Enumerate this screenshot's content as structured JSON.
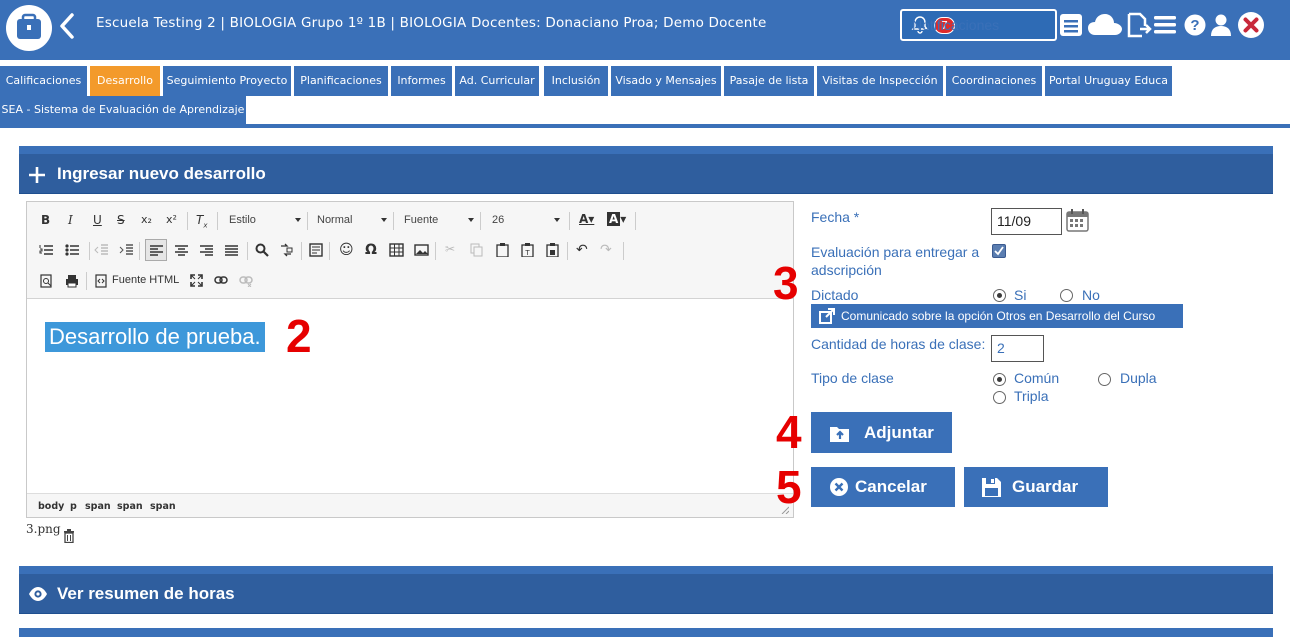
{
  "header": {
    "breadcrumb": "Escuela Testing 2 | BIOLOGIA Grupo 1º 1B | BIOLOGIA Docentes: Donaciano Proa; Demo Docente",
    "notifications_label": "Notificaciones",
    "notifications_count": "7"
  },
  "tabs": [
    "Calificaciones",
    "Desarrollo",
    "Seguimiento Proyecto",
    "Planificaciones",
    "Informes",
    "Ad. Curricular",
    "Inclusión",
    "Visado y Mensajes",
    "Pasaje de lista",
    "Visitas de Inspección",
    "Coordinaciones",
    "Portal Uruguay Educa",
    "SEA - Sistema de Evaluación de Aprendizaje"
  ],
  "active_tab": "Desarrollo",
  "sections": {
    "new": "Ingresar nuevo desarrollo",
    "summary": "Ver resumen de horas"
  },
  "editor": {
    "style_combo": "Estilo",
    "format_combo": "Normal",
    "font_combo": "Fuente",
    "size_combo": "26",
    "source_label": "Fuente HTML",
    "content": "Desarrollo de prueba.",
    "path": [
      "body",
      "p",
      "span",
      "span",
      "span"
    ]
  },
  "attachment": {
    "filename": "3.png"
  },
  "annotations": [
    "2",
    "3",
    "4",
    "5"
  ],
  "form": {
    "fecha_label": "Fecha *",
    "fecha_value": "11/09",
    "eval_label": "Evaluación para entregar a adscripción",
    "eval_checked": true,
    "dictado_label": "Dictado",
    "dictado_options": [
      "Si",
      "No"
    ],
    "dictado_selected": "Si",
    "comunicado_button": "Comunicado sobre la opción Otros en Desarrollo del Curso",
    "horas_label": "Cantidad de horas de clase:",
    "horas_value": "2",
    "tipo_label": "Tipo de clase",
    "tipo_options": [
      "Común",
      "Dupla",
      "Tripla"
    ],
    "tipo_selected": "Común"
  },
  "buttons": {
    "adjuntar": "Adjuntar",
    "cancelar": "Cancelar",
    "guardar": "Guardar"
  },
  "colors": {
    "primary": "#3a70b8",
    "active_tab": "#f39a2b",
    "annotation": "#e60000"
  }
}
